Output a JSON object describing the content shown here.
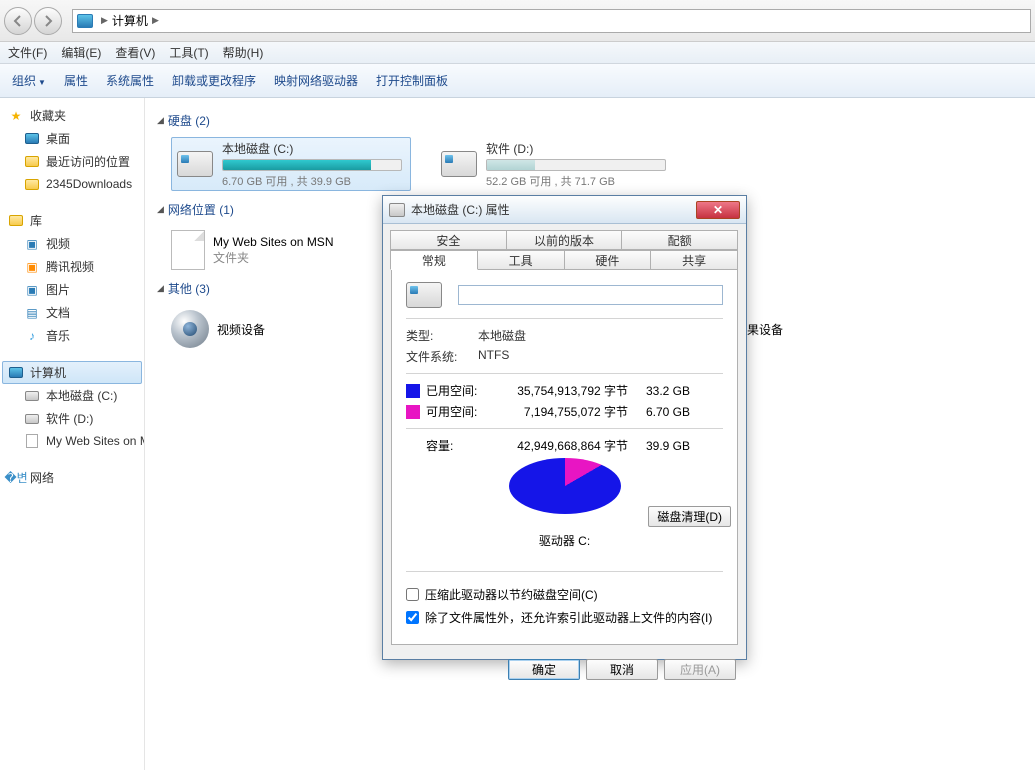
{
  "breadcrumb": {
    "root": "计算机",
    "arrow": "▶"
  },
  "menus": [
    "文件(F)",
    "编辑(E)",
    "查看(V)",
    "工具(T)",
    "帮助(H)"
  ],
  "toolbar": {
    "organize": "组织",
    "properties": "属性",
    "sysprops": "系统属性",
    "uninstall": "卸载或更改程序",
    "mapnet": "映射网络驱动器",
    "controlpanel": "打开控制面板"
  },
  "sidebar": {
    "favorites": {
      "label": "收藏夹",
      "items": [
        "桌面",
        "最近访问的位置",
        "2345Downloads"
      ]
    },
    "libraries": {
      "label": "库",
      "items": [
        "视频",
        "腾讯视频",
        "图片",
        "文档",
        "音乐"
      ]
    },
    "computer": {
      "label": "计算机",
      "items": [
        "本地磁盘 (C:)",
        "软件 (D:)",
        "My Web Sites on MSN"
      ]
    },
    "network": {
      "label": "网络"
    }
  },
  "sections": {
    "hdd": {
      "title": "硬盘 (2)"
    },
    "netloc": {
      "title": "网络位置 (1)"
    },
    "other": {
      "title": "其他 (3)"
    }
  },
  "drives": [
    {
      "label": "本地磁盘 (C:)",
      "sub": "6.70 GB 可用 , 共 39.9 GB",
      "fill_pct": 83
    },
    {
      "label": "软件 (D:)",
      "sub": "52.2 GB 可用 , 共 71.7 GB",
      "fill_pct": 27
    }
  ],
  "netloc_item": {
    "name": "My Web Sites on MSN",
    "type": "文件夹"
  },
  "other_items": [
    {
      "name": "视频设备"
    },
    {
      "name": "苹果设备"
    }
  ],
  "dialog": {
    "title": "本地磁盘 (C:) 属性",
    "tabs_row1": [
      "安全",
      "以前的版本",
      "配额"
    ],
    "tabs_row2": [
      "常规",
      "工具",
      "硬件",
      "共享"
    ],
    "active_tab": "常规",
    "name_value": "",
    "type_label": "类型:",
    "type_value": "本地磁盘",
    "fs_label": "文件系统:",
    "fs_value": "NTFS",
    "used_label": "已用空间:",
    "used_bytes": "35,754,913,792 字节",
    "used_gb": "33.2 GB",
    "free_label": "可用空间:",
    "free_bytes": "7,194,755,072 字节",
    "free_gb": "6.70 GB",
    "cap_label": "容量:",
    "cap_bytes": "42,949,668,864 字节",
    "cap_gb": "39.9 GB",
    "drive_caption": "驱动器 C:",
    "cleanup": "磁盘清理(D)",
    "chk_compress": "压缩此驱动器以节约磁盘空间(C)",
    "chk_index": "除了文件属性外，还允许索引此驱动器上文件的内容(I)",
    "ok": "确定",
    "cancel": "取消",
    "apply": "应用(A)"
  },
  "chart_data": {
    "type": "pie",
    "title": "驱动器 C:",
    "series": [
      {
        "name": "已用空间",
        "value": 33.2,
        "unit": "GB",
        "color": "#1515e8"
      },
      {
        "name": "可用空间",
        "value": 6.7,
        "unit": "GB",
        "color": "#e815c3"
      }
    ]
  }
}
